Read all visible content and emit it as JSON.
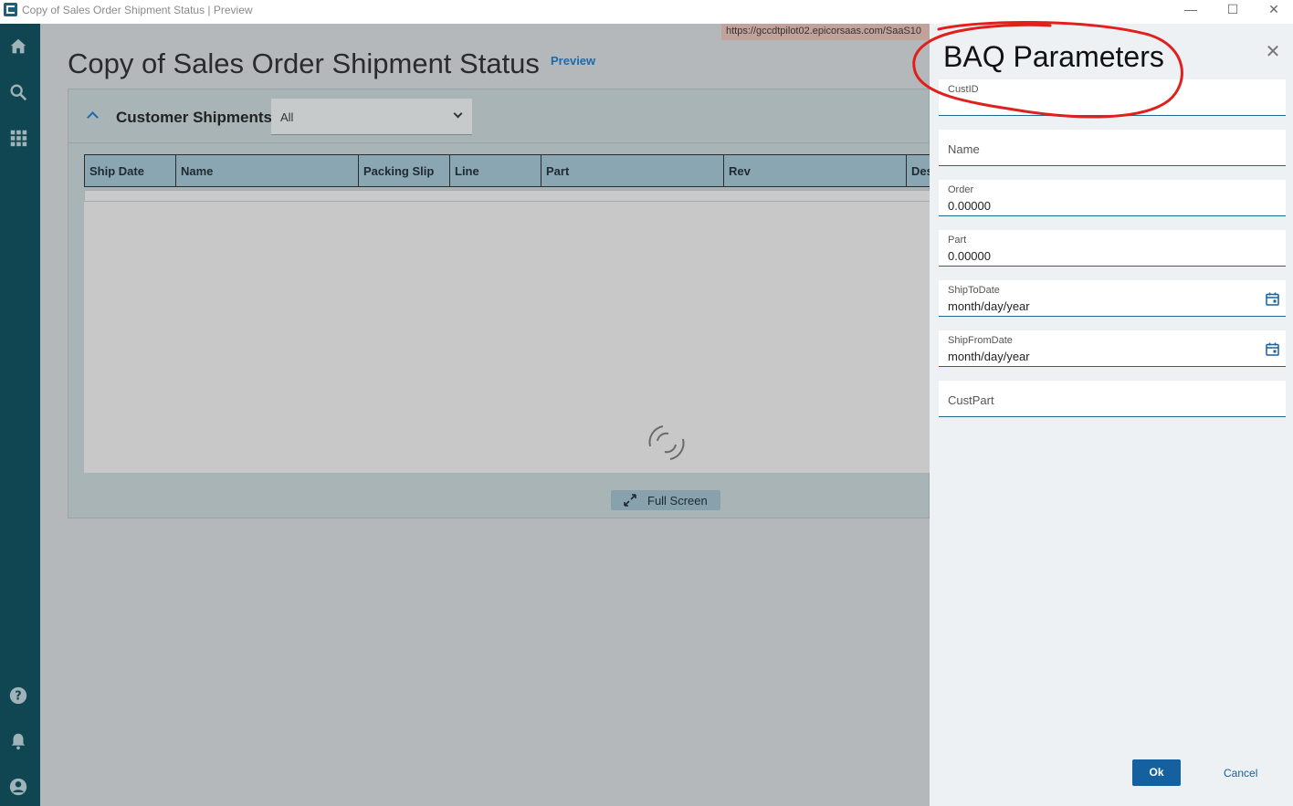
{
  "window": {
    "title": "Copy of Sales Order Shipment Status | Preview",
    "minimize_glyph": "—",
    "maximize_glyph": "☐",
    "close_glyph": "✕"
  },
  "rail": {
    "top_icons": [
      "home-icon",
      "search-icon",
      "apps-grid-icon"
    ],
    "bottom_icons": [
      "help-icon",
      "notifications-icon",
      "account-icon"
    ]
  },
  "url_hint": "https://gccdtpilot02.epicorsaas.com/SaaS10",
  "page": {
    "title": "Copy of Sales Order Shipment Status",
    "preview_label": "Preview"
  },
  "panel": {
    "title": "Customer Shipments",
    "filter_value": "All",
    "columns": [
      "Ship Date",
      "Name",
      "Packing Slip",
      "Line",
      "Part",
      "Rev",
      "Des"
    ],
    "fullscreen_label": "Full Screen"
  },
  "drawer": {
    "title": "BAQ Parameters",
    "close_glyph": "✕",
    "fields": [
      {
        "label": "CustID",
        "value": ""
      },
      {
        "label": "Name",
        "value": ""
      },
      {
        "label": "Order",
        "value": "0.00000"
      },
      {
        "label": "Part",
        "value": "0.00000"
      },
      {
        "label": "ShipToDate",
        "value": "month/day/year"
      },
      {
        "label": "ShipFromDate",
        "value": "month/day/year"
      },
      {
        "label": "CustPart",
        "value": ""
      }
    ],
    "ok_label": "Ok",
    "cancel_label": "Cancel"
  },
  "colors": {
    "rail": "#0f4652",
    "accent": "#1561a0",
    "annotation": "#e0201c"
  }
}
